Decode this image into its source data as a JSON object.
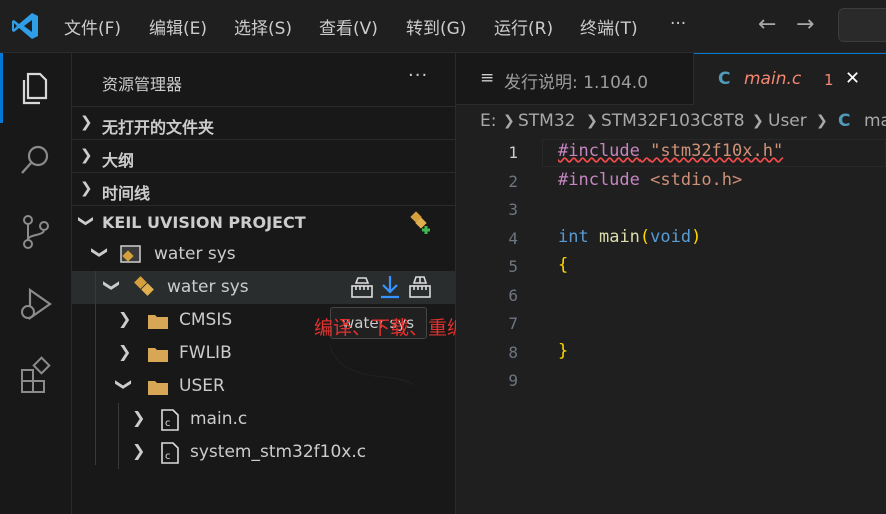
{
  "menu": [
    "文件(F)",
    "编辑(E)",
    "选择(S)",
    "查看(V)",
    "转到(G)",
    "运行(R)",
    "终端(T)",
    "···"
  ],
  "nav": {
    "back": "←",
    "forward": "→"
  },
  "sidebar": {
    "title": "资源管理器",
    "more": "···",
    "sections": [
      {
        "label": "无打开的文件夹"
      },
      {
        "label": "大纲"
      },
      {
        "label": "时间线"
      },
      {
        "label": "KEIL UVISION PROJECT"
      }
    ],
    "tree": {
      "project": "water sys",
      "target": "water sys",
      "folders": [
        "CMSIS",
        "FWLIB",
        "USER"
      ],
      "files": [
        "main.c",
        "system_stm32f10x.c"
      ]
    }
  },
  "tooltip": "water sys",
  "annotation": "编译、下载、重编译",
  "tabs": [
    {
      "icon": "≡",
      "label": "发行说明: 1.104.0"
    },
    {
      "icon": "C",
      "label": "main.c",
      "problems": "1",
      "close": "✕"
    }
  ],
  "breadcrumb": [
    "E:",
    "STM32",
    "STM32F103C8T8",
    "User",
    "ma"
  ],
  "editor": {
    "line_numbers": [
      "1",
      "2",
      "3",
      "4",
      "5",
      "6",
      "7",
      "8",
      "9"
    ],
    "lines": [
      "#include \"stm32f10x.h\"",
      "#include <stdio.h>",
      "",
      "int main(void)",
      "{",
      "",
      "",
      "}",
      ""
    ]
  },
  "colors": {
    "accent": "#0078d4",
    "error": "#f14c4c",
    "keyword": "#569cd6",
    "string": "#ce9178",
    "directive": "#c586c0",
    "function": "#dcdcaa",
    "brace": "#ffd700"
  }
}
